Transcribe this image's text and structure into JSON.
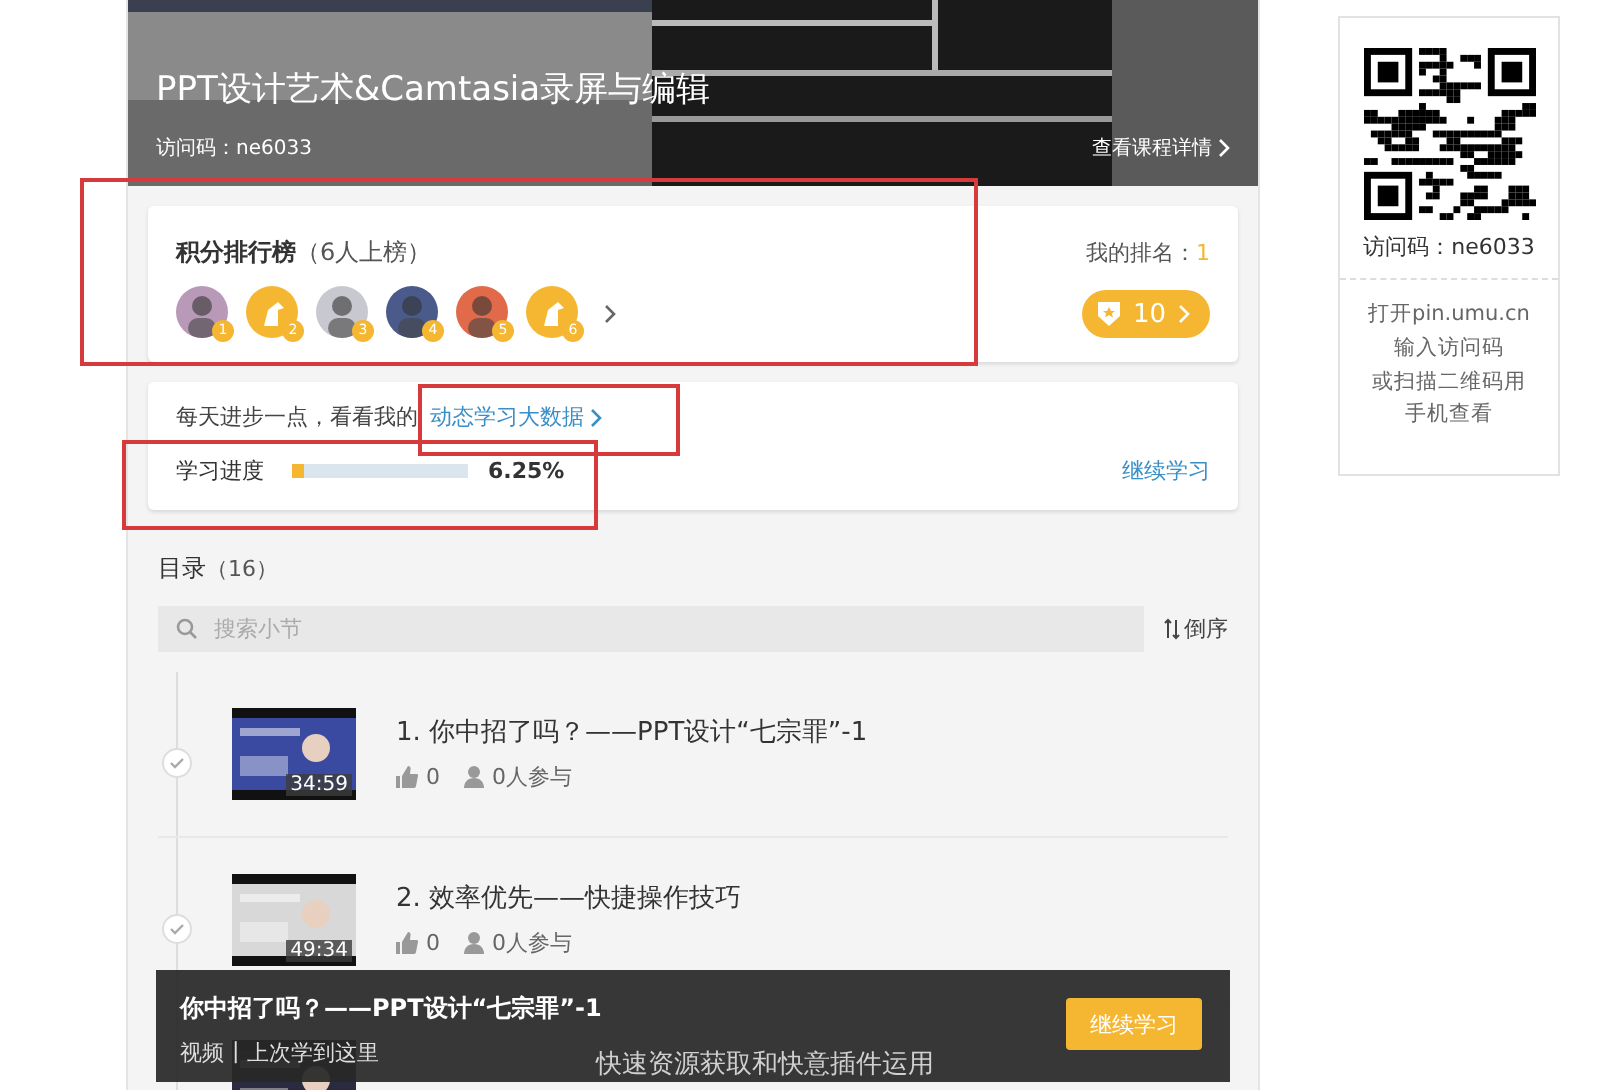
{
  "course": {
    "title": "PPT设计艺术&Camtasia录屏与编辑",
    "access_code": "访问码：ne6033",
    "details_link": "查看课程详情"
  },
  "leaderboard": {
    "title": "积分排行榜",
    "count": "（6人上榜）",
    "my_rank_label": "我的排名：",
    "my_rank": "1",
    "points": "10",
    "members": [
      {
        "rank": "1"
      },
      {
        "kind": "default",
        "rank": "2"
      },
      {
        "rank": "3"
      },
      {
        "rank": "4"
      },
      {
        "rank": "5"
      },
      {
        "kind": "default",
        "rank": "6"
      }
    ]
  },
  "progress": {
    "prompt": "每天进步一点，看看我的",
    "link": "动态学习大数据",
    "label": "学习进度",
    "level": 0.0625,
    "reading": "6.25%",
    "action": "继续学习"
  },
  "catalog": {
    "title": "目录",
    "count": "（16）",
    "search": {
      "placeholder": "搜索小节"
    },
    "sort": "倒序",
    "items": [
      {
        "title": "1. 你中招了吗？——PPT设计“七宗罪”-1",
        "duration": "34:59",
        "likes": "0",
        "participants": "0人参与",
        "done": true,
        "kind": "lesson"
      },
      {
        "title": "2. 效率优先——快捷操作技巧",
        "duration": "49:34",
        "likes": "0",
        "participants": "0人参与",
        "done": true,
        "kind": "lesson"
      },
      {
        "title": "快速资源获取和快意插件运用",
        "kind": "partial"
      }
    ]
  },
  "resume_bar": {
    "title": "你中招了吗？——PPT设计“七宗罪”-1",
    "type": "视频",
    "separator": "|",
    "note": "上次学到这里",
    "button": "继续学习"
  },
  "qr_card": {
    "access_code": "访问码：ne6033",
    "instructions": [
      "打开pin.umu.cn",
      "输入访问码",
      "或扫描二维码用",
      "手机查看"
    ]
  }
}
